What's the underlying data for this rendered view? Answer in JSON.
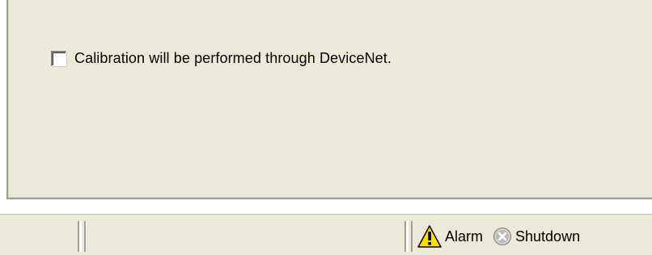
{
  "panel": {
    "calibration_checkbox": {
      "label": "Calibration will be performed through DeviceNet.",
      "checked": false
    }
  },
  "status_bar": {
    "cell_1_text": "",
    "cell_2_text": "",
    "alarm": {
      "label": "Alarm",
      "icon": "warning-triangle-icon",
      "color": "#ffe000"
    },
    "shutdown": {
      "label": "Shutdown",
      "icon": "x-circle-icon",
      "color": "#b8b8b8"
    }
  }
}
